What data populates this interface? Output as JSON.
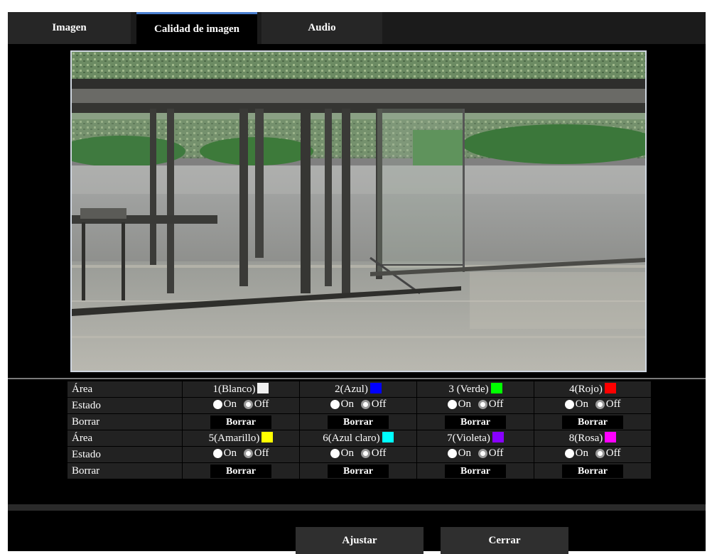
{
  "tabs": [
    {
      "label": "Imagen",
      "active": false
    },
    {
      "label": "Calidad de imagen",
      "active": true
    },
    {
      "label": "Audio",
      "active": false
    }
  ],
  "areas_table": {
    "rows": [
      {
        "area_label": "Área",
        "state_label": "Estado",
        "clear_label": "Borrar",
        "areas": [
          {
            "name": "1(Blanco)",
            "color": "#ffffff",
            "on_label": "On",
            "off_label": "Off",
            "state": "Off",
            "clear_button": "Borrar"
          },
          {
            "name": "2(Azul)",
            "color": "#0000ff",
            "on_label": "On",
            "off_label": "Off",
            "state": "Off",
            "clear_button": "Borrar"
          },
          {
            "name": "3 (Verde)",
            "color": "#00ff00",
            "on_label": "On",
            "off_label": "Off",
            "state": "Off",
            "clear_button": "Borrar"
          },
          {
            "name": "4(Rojo)",
            "color": "#ff0000",
            "on_label": "On",
            "off_label": "Off",
            "state": "Off",
            "clear_button": "Borrar"
          }
        ]
      },
      {
        "area_label": "Área",
        "state_label": "Estado",
        "clear_label": "Borrar",
        "areas": [
          {
            "name": "5(Amarillo)",
            "color": "#ffff00",
            "on_label": "On",
            "off_label": "Off",
            "state": "Off",
            "clear_button": "Borrar"
          },
          {
            "name": "6(Azul claro)",
            "color": "#00ffff",
            "on_label": "On",
            "off_label": "Off",
            "state": "Off",
            "clear_button": "Borrar"
          },
          {
            "name": "7(Violeta)",
            "color": "#8800ff",
            "on_label": "On",
            "off_label": "Off",
            "state": "Off",
            "clear_button": "Borrar"
          },
          {
            "name": "8(Rosa)",
            "color": "#ff00ff",
            "on_label": "On",
            "off_label": "Off",
            "state": "Off",
            "clear_button": "Borrar"
          }
        ]
      }
    ]
  },
  "buttons": {
    "set_label": "Ajustar",
    "close_label": "Cerrar"
  }
}
